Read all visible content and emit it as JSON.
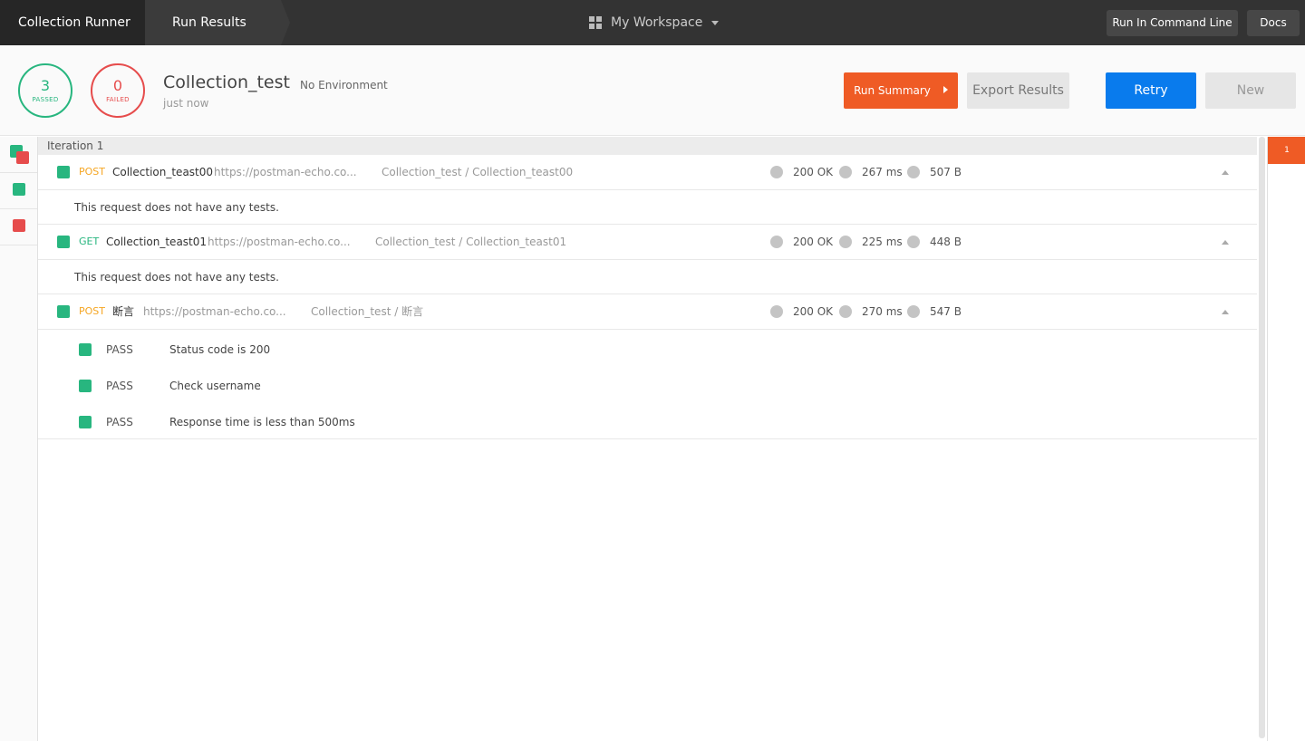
{
  "topbar": {
    "crumbs": [
      "Collection Runner",
      "Run Results"
    ],
    "workspace": "My Workspace",
    "run_cmd_label": "Run In Command Line",
    "docs_label": "Docs"
  },
  "summary": {
    "passed_count": "3",
    "passed_label": "PASSED",
    "failed_count": "0",
    "failed_label": "FAILED",
    "collection": "Collection_test",
    "environment": "No Environment",
    "time": "just now",
    "run_summary_label": "Run Summary",
    "export_label": "Export Results",
    "retry_label": "Retry",
    "new_label": "New"
  },
  "iteration": {
    "label": "Iteration 1",
    "minimap_label": "1"
  },
  "requests": [
    {
      "method": "POST",
      "name": "Collection_teast00",
      "url": "https://postman-echo.co...",
      "path": "Collection_test / Collection_teast00",
      "status": "200 OK",
      "time": "267 ms",
      "size": "507 B",
      "no_tests": "This request does not have any tests."
    },
    {
      "method": "GET",
      "name": "Collection_teast01",
      "url": "https://postman-echo.co...",
      "path": "Collection_test / Collection_teast01",
      "status": "200 OK",
      "time": "225 ms",
      "size": "448 B",
      "no_tests": "This request does not have any tests."
    },
    {
      "method": "POST",
      "name": "断言",
      "url": "https://postman-echo.co...",
      "path": "Collection_test / 断言",
      "status": "200 OK",
      "time": "270 ms",
      "size": "547 B",
      "tests": [
        {
          "result": "PASS",
          "name": "Status code is 200"
        },
        {
          "result": "PASS",
          "name": "Check username"
        },
        {
          "result": "PASS",
          "name": "Response time is less than 500ms"
        }
      ]
    }
  ],
  "colors": {
    "pass": "#28b67f",
    "fail": "#e64c4c",
    "accent": "#ef5b25",
    "primary": "#097bed",
    "post": "#f5a623",
    "get": "#28b67f"
  }
}
